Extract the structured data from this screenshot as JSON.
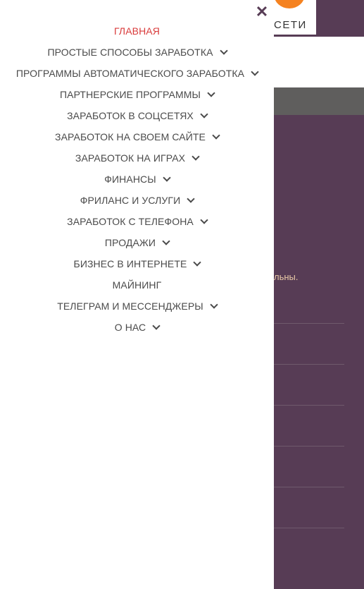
{
  "background": {
    "logo_text": "СЕТИ",
    "snippet": "льны.",
    "colors": {
      "purple": "#573c55",
      "orange": "#f58220",
      "grey": "#5f5e5d"
    }
  },
  "drawer": {
    "close_icon": "close-icon",
    "menu": [
      {
        "label": "ГЛАВНАЯ",
        "active": true,
        "has_submenu": false
      },
      {
        "label": "ПРОСТЫЕ СПОСОБЫ ЗАРАБОТКА",
        "active": false,
        "has_submenu": true
      },
      {
        "label": "ПРОГРАММЫ АВТОМАТИЧЕСКОГО ЗАРАБОТКА",
        "active": false,
        "has_submenu": true
      },
      {
        "label": "ПАРТНЕРСКИЕ ПРОГРАММЫ",
        "active": false,
        "has_submenu": true
      },
      {
        "label": "ЗАРАБОТОК В СОЦСЕТЯХ",
        "active": false,
        "has_submenu": true
      },
      {
        "label": "ЗАРАБОТОК НА СВОЕМ САЙТЕ",
        "active": false,
        "has_submenu": true
      },
      {
        "label": "ЗАРАБОТОК НА ИГРАХ",
        "active": false,
        "has_submenu": true
      },
      {
        "label": "ФИНАНСЫ",
        "active": false,
        "has_submenu": true
      },
      {
        "label": "ФРИЛАНС И УСЛУГИ",
        "active": false,
        "has_submenu": true
      },
      {
        "label": "ЗАРАБОТОК С ТЕЛЕФОНА",
        "active": false,
        "has_submenu": true
      },
      {
        "label": "ПРОДАЖИ",
        "active": false,
        "has_submenu": true
      },
      {
        "label": "БИЗНЕС В ИНТЕРНЕТЕ",
        "active": false,
        "has_submenu": true
      },
      {
        "label": "МАЙНИНГ",
        "active": false,
        "has_submenu": false
      },
      {
        "label": "ТЕЛЕГРАМ И МЕССЕНДЖЕРЫ",
        "active": false,
        "has_submenu": true
      },
      {
        "label": "О НАС",
        "active": false,
        "has_submenu": true
      }
    ]
  }
}
